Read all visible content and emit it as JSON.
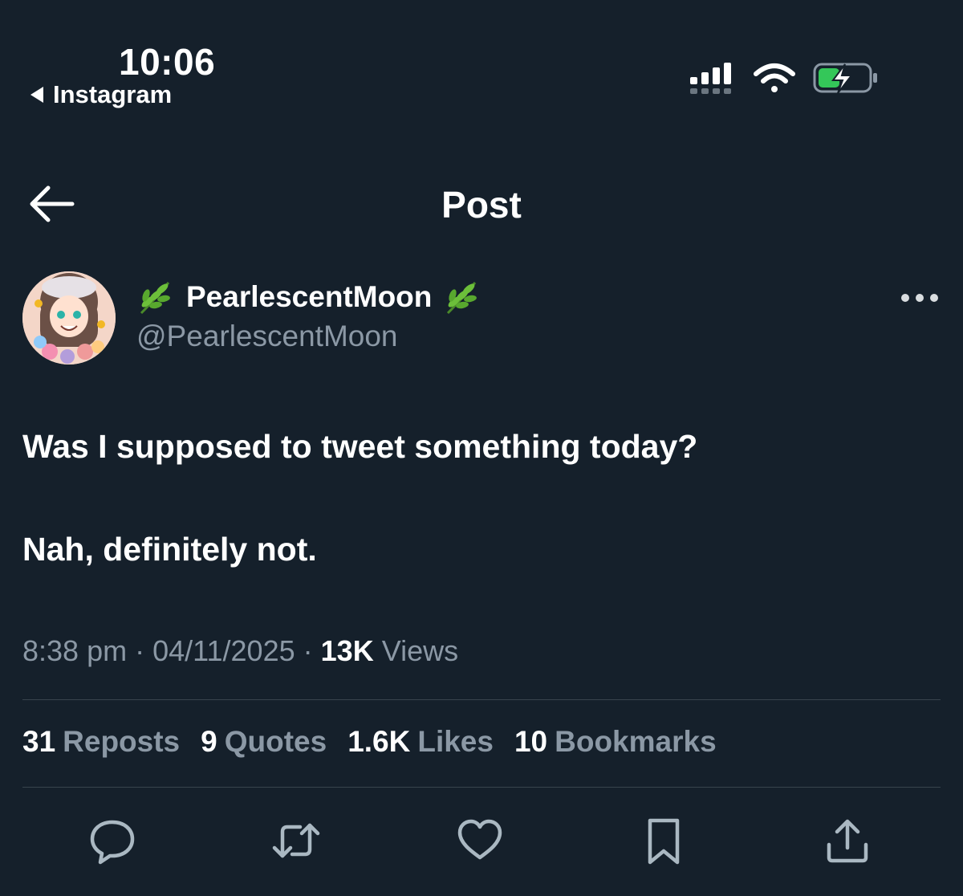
{
  "status_bar": {
    "time": "10:06",
    "back_app_label": "Instagram",
    "battery_color": "#34c759"
  },
  "header": {
    "title": "Post"
  },
  "author": {
    "display_name": "PearlescentMoon",
    "name_emoji": "herb",
    "handle": "@PearlescentMoon"
  },
  "tweet": {
    "paragraphs": [
      "Was I supposed to tweet something today?",
      "Nah, definitely not."
    ],
    "time": "8:38 pm",
    "separator": "·",
    "date": "04/11/2025",
    "views_count": "13K",
    "views_label": "Views"
  },
  "stats": [
    {
      "count": "31",
      "label": "Reposts"
    },
    {
      "count": "9",
      "label": "Quotes"
    },
    {
      "count": "1.6K",
      "label": "Likes"
    },
    {
      "count": "10",
      "label": "Bookmarks"
    }
  ],
  "actions": [
    "reply-icon",
    "repost-icon",
    "like-icon",
    "bookmark-icon",
    "share-icon"
  ],
  "colors": {
    "background": "#15202b",
    "primary_text": "#ffffff",
    "secondary_text": "#8b98a5",
    "divider": "#38444d"
  }
}
